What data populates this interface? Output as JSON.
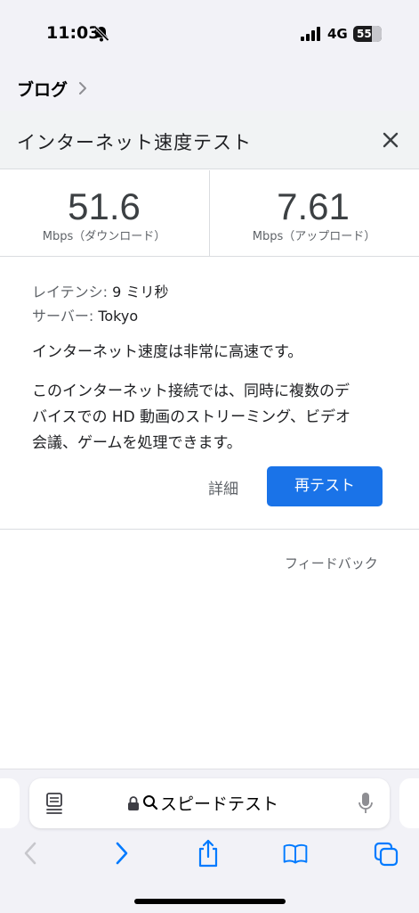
{
  "status_bar": {
    "time": "11:03",
    "network": "4G",
    "battery": "55"
  },
  "breadcrumb": {
    "label": "ブログ"
  },
  "card": {
    "title": "インターネット速度テスト",
    "download": {
      "value": "51.6",
      "unit": "Mbps（ダウンロード）"
    },
    "upload": {
      "value": "7.61",
      "unit": "Mbps（アップロード）"
    },
    "latency": {
      "label": "レイテンシ:",
      "value": "9 ミリ秒"
    },
    "server": {
      "label": "サーバー:",
      "value": "Tokyo"
    },
    "summary": "インターネット速度は非常に高速です。",
    "description_lines": [
      "このインターネット接続では、同時に複数のデ",
      "バイスでの HD 動画のストリーミング、ビデオ",
      "会議、ゲームを処理できます。"
    ],
    "details_label": "詳細",
    "retest_label": "再テスト",
    "feedback_label": "フィードバック"
  },
  "address_bar": {
    "text": "スピードテスト"
  },
  "icons": [
    "bell-slash-icon",
    "signal-icon",
    "chevron-right-icon",
    "close-icon",
    "reader-icon",
    "lock-icon",
    "search-icon",
    "mic-icon",
    "back-icon",
    "forward-icon",
    "share-icon",
    "bookmarks-icon",
    "tabs-icon"
  ],
  "colors": {
    "accent": "#1a73e8",
    "ios_blue": "#007aff"
  }
}
